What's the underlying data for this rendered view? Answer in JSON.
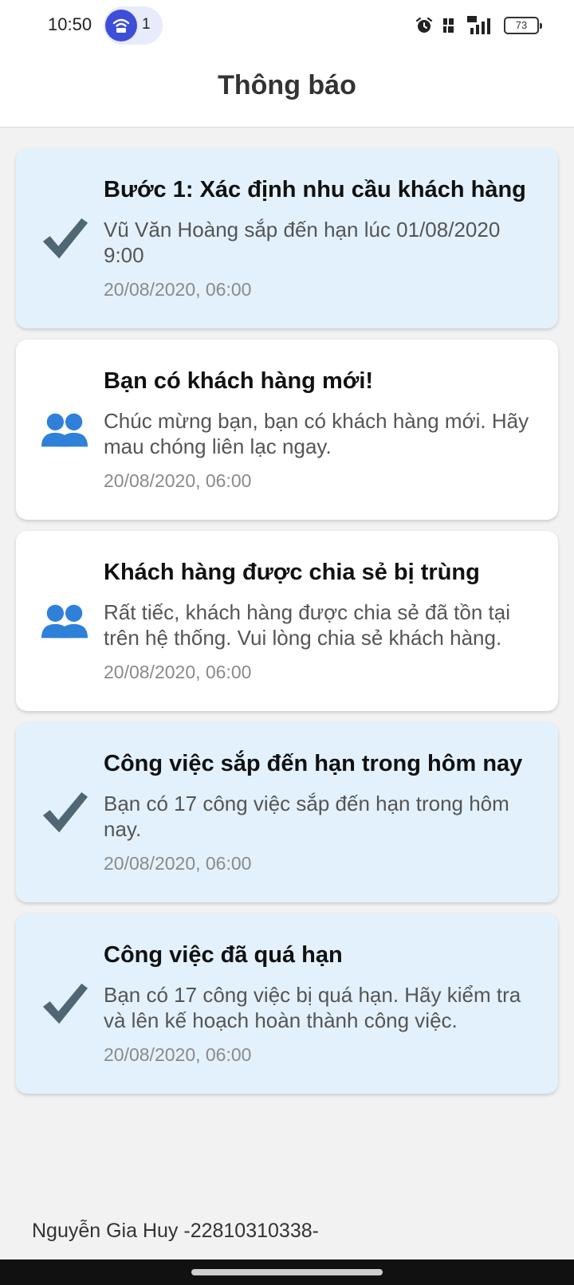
{
  "status_bar": {
    "time": "10:50",
    "hotspot_count": "1",
    "battery_level": "73",
    "icons": [
      "wifi-hotspot-icon",
      "alarm-clock-icon",
      "volte-icon",
      "signal-4g-icon",
      "battery-icon"
    ]
  },
  "header": {
    "title": "Thông báo"
  },
  "notifications": [
    {
      "title": "Bước 1: Xác định nhu cầu khách hàng",
      "body": "Vũ Văn Hoàng sắp đến hạn lúc 01/08/2020 9:00",
      "time": "20/08/2020, 06:00",
      "icon": "checkmark-icon",
      "unread": true
    },
    {
      "title": "Bạn có khách hàng mới!",
      "body": "Chúc mừng bạn, bạn có khách hàng mới. Hãy mau chóng liên lạc ngay.",
      "time": "20/08/2020, 06:00",
      "icon": "users-icon",
      "unread": false
    },
    {
      "title": "Khách hàng được chia sẻ bị trùng",
      "body": "Rất tiếc, khách hàng được chia sẻ đã tồn tại trên hệ thống. Vui lòng chia sẻ khách hàng.",
      "time": "20/08/2020, 06:00",
      "icon": "users-icon",
      "unread": false
    },
    {
      "title": "Công việc sắp đến hạn trong hôm nay",
      "body": "Bạn có 17 công việc sắp đến hạn trong hôm nay.",
      "time": "20/08/2020, 06:00",
      "icon": "checkmark-icon",
      "unread": true
    },
    {
      "title": "Công việc đã quá hạn",
      "body": "Bạn có 17 công việc bị quá hạn. Hãy kiểm tra và lên kế hoạch hoàn thành công việc.",
      "time": "20/08/2020, 06:00",
      "icon": "checkmark-icon",
      "unread": true
    }
  ],
  "footer": {
    "text": "Nguyễn Gia Huy -22810310338-"
  },
  "colors": {
    "unread_card": "#e3f1fd",
    "read_card": "#ffffff",
    "check_icon": "#4f6774",
    "users_icon": "#2f80d8"
  }
}
